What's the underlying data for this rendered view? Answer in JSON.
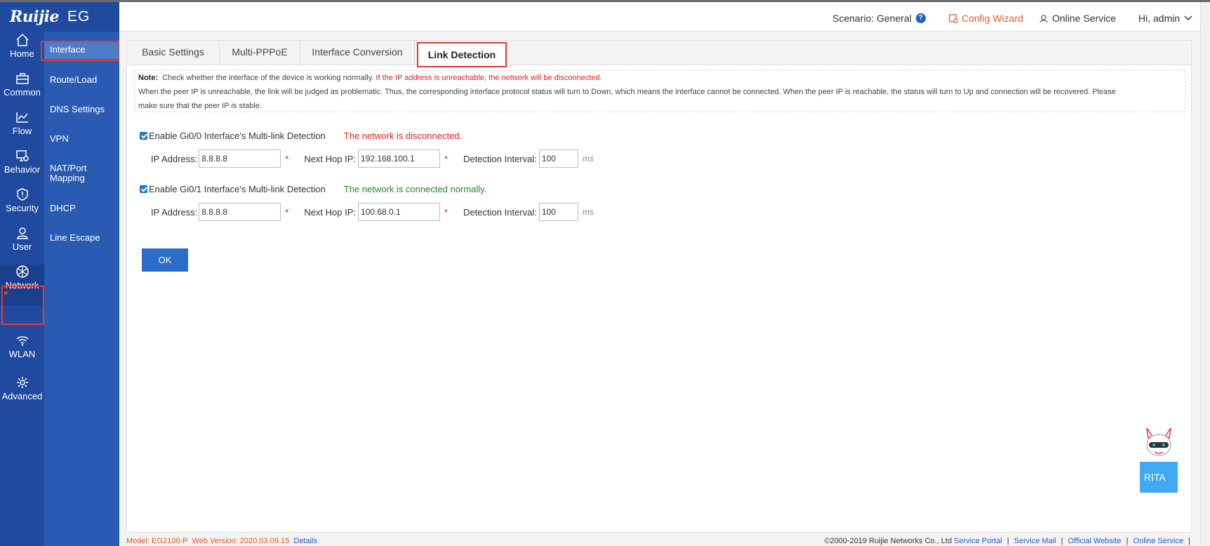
{
  "brand": {
    "logo": "Ruijie",
    "product": "EG"
  },
  "sidebar": {
    "items": [
      {
        "label": "Home",
        "icon": "home-icon"
      },
      {
        "label": "Common",
        "icon": "briefcase-icon"
      },
      {
        "label": "Flow",
        "icon": "chart-line-icon"
      },
      {
        "label": "Behavior",
        "icon": "monitor-gear-icon"
      },
      {
        "label": "Security",
        "icon": "shield-icon"
      },
      {
        "label": "User",
        "icon": "user-icon"
      },
      {
        "label": "Network",
        "icon": "globe-icon"
      },
      {
        "label": "WLAN",
        "icon": "wifi-icon"
      },
      {
        "label": "Advanced",
        "icon": "gear-icon"
      }
    ]
  },
  "subnav": {
    "items": [
      {
        "label": "Interface"
      },
      {
        "label": "Route/Load"
      },
      {
        "label": "DNS Settings"
      },
      {
        "label": "VPN"
      },
      {
        "label": "NAT/Port Mapping"
      },
      {
        "label": "DHCP"
      },
      {
        "label": "Line Escape"
      }
    ]
  },
  "header": {
    "scenario_label": "Scenario:",
    "scenario_value": "General",
    "help": "?",
    "config_wizard": "Config Wizard",
    "online_service": "Online Service",
    "greeting": "Hi, admin"
  },
  "tabs": [
    {
      "label": "Basic Settings"
    },
    {
      "label": "Multi-PPPoE"
    },
    {
      "label": "Interface Conversion"
    },
    {
      "label": "Link Detection"
    }
  ],
  "note": {
    "label": "Note:",
    "text1": "Check whether the interface of the device is working normally.",
    "text1_red": "If the IP address is unreachable, the network will be disconnected.",
    "text2": "When the peer IP is unreachable, the link will be judged as problematic. Thus, the corresponding interface protocol status will turn to Down, which means the interface cannot be connected. When the peer IP is reachable, the status will turn to Up and connection will be recovered. Please",
    "text3": "make sure that the peer IP is stable."
  },
  "detections": [
    {
      "label": "Enable Gi0/0 Interface's Multi-link Detection",
      "status": "The network is disconnected.",
      "ip_label": "IP Address:",
      "ip": "8.8.8.8",
      "hop_label": "Next Hop IP:",
      "hop": "192.168.100.1",
      "interval_label": "Detection Interval:",
      "interval": "100",
      "unit": "ms"
    },
    {
      "label": "Enable Gi0/1 Interface's Multi-link Detection",
      "status": "The network is connected normally.",
      "ip_label": "IP Address:",
      "ip": "8.8.8.8",
      "hop_label": "Next Hop IP:",
      "hop": "100.68.0.1",
      "interval_label": "Detection Interval:",
      "interval": "100",
      "unit": "ms"
    }
  ],
  "ok_label": "OK",
  "rita_label": "RITA",
  "footer": {
    "model_label": "Model:",
    "model": "EG2100-P",
    "version_label": "Web Version:",
    "version": "2020.03.09.15",
    "details": "Details",
    "copyright": "©2000-2019 Ruijie Networks Co., Ltd",
    "links": [
      "Service Portal",
      "Service Mail",
      "Official Website",
      "Online Service"
    ]
  },
  "colors": {
    "sidebar": "#1f4aa0",
    "subnav": "#2a5bb3",
    "accent_red": "#e53935",
    "orange": "#f05a22",
    "green": "#1e8a1e",
    "button": "#2a6cc7"
  }
}
